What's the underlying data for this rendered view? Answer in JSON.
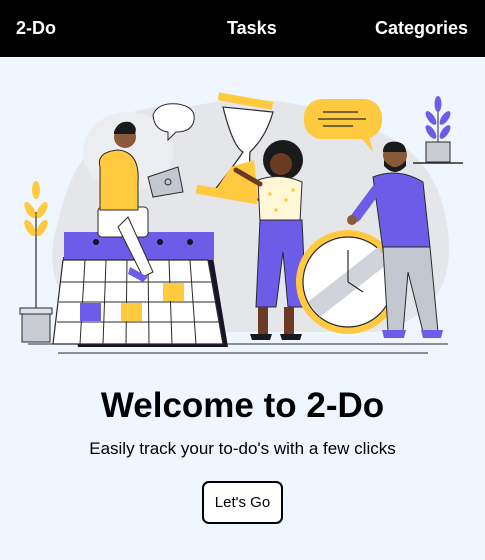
{
  "nav": {
    "brand": "2-Do",
    "links": [
      {
        "label": "Tasks"
      },
      {
        "label": "Categories"
      }
    ]
  },
  "hero": {
    "title": "Welcome to 2-Do",
    "subtitle": "Easily track your to-do's with a few clicks",
    "cta_label": "Let's Go",
    "illustration_icon": "task-planning-illustration"
  },
  "colors": {
    "navbar_bg": "#000000",
    "page_bg": "#eff6ff",
    "accent_purple": "#6c5ce7",
    "accent_yellow": "#ffc940"
  }
}
